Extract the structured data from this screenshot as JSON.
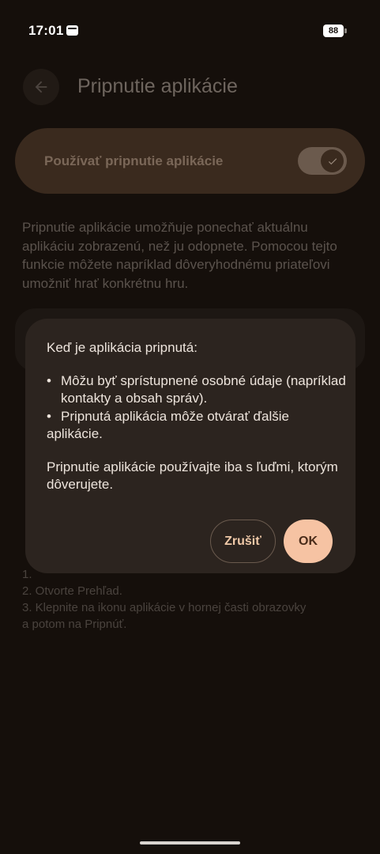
{
  "status_bar": {
    "time": "17:01",
    "battery": "88",
    "icons": [
      "sim-card-icon",
      "battery-icon"
    ]
  },
  "page": {
    "title": "Pripnutie aplikácie",
    "back_icon": "arrow-left-icon",
    "toggle": {
      "label": "Používať pripnutie aplikácie",
      "state": true,
      "icon": "check-icon"
    },
    "description": "Pripnutie aplikácie umožňuje ponechať aktuálnu aplikáciu zobrazenú, než ju odopnete. Pomocou tejto funkcie môžete napríklad dôveryhodnému priateľovi umožniť hrať konkrétnu hru.",
    "steps": {
      "line_1": "1.",
      "line_2": "2. Otvorte Prehľad.",
      "line_3": "3. Klepnite na ikonu aplikácie v hornej časti obrazovky",
      "line_4": "a potom na Pripnúť."
    }
  },
  "dialog": {
    "heading": "Keď je aplikácia pripnutá:",
    "bullets": [
      "Môžu byť sprístupnené osobné údaje (napríklad kontakty a obsah správ).",
      "Pripnutá aplikácia môže otvárať ďalšie aplikácie."
    ],
    "bullet_symbol": "•",
    "note": "Pripnutie aplikácie používajte iba s ľuďmi, ktorým dôverujete.",
    "cancel_label": "Zrušiť",
    "ok_label": "OK"
  },
  "colors": {
    "background": "#150f0b",
    "dialog": "#2c241f",
    "accent": "#f6c3a3",
    "toggle_card": "#3a2a1e"
  }
}
